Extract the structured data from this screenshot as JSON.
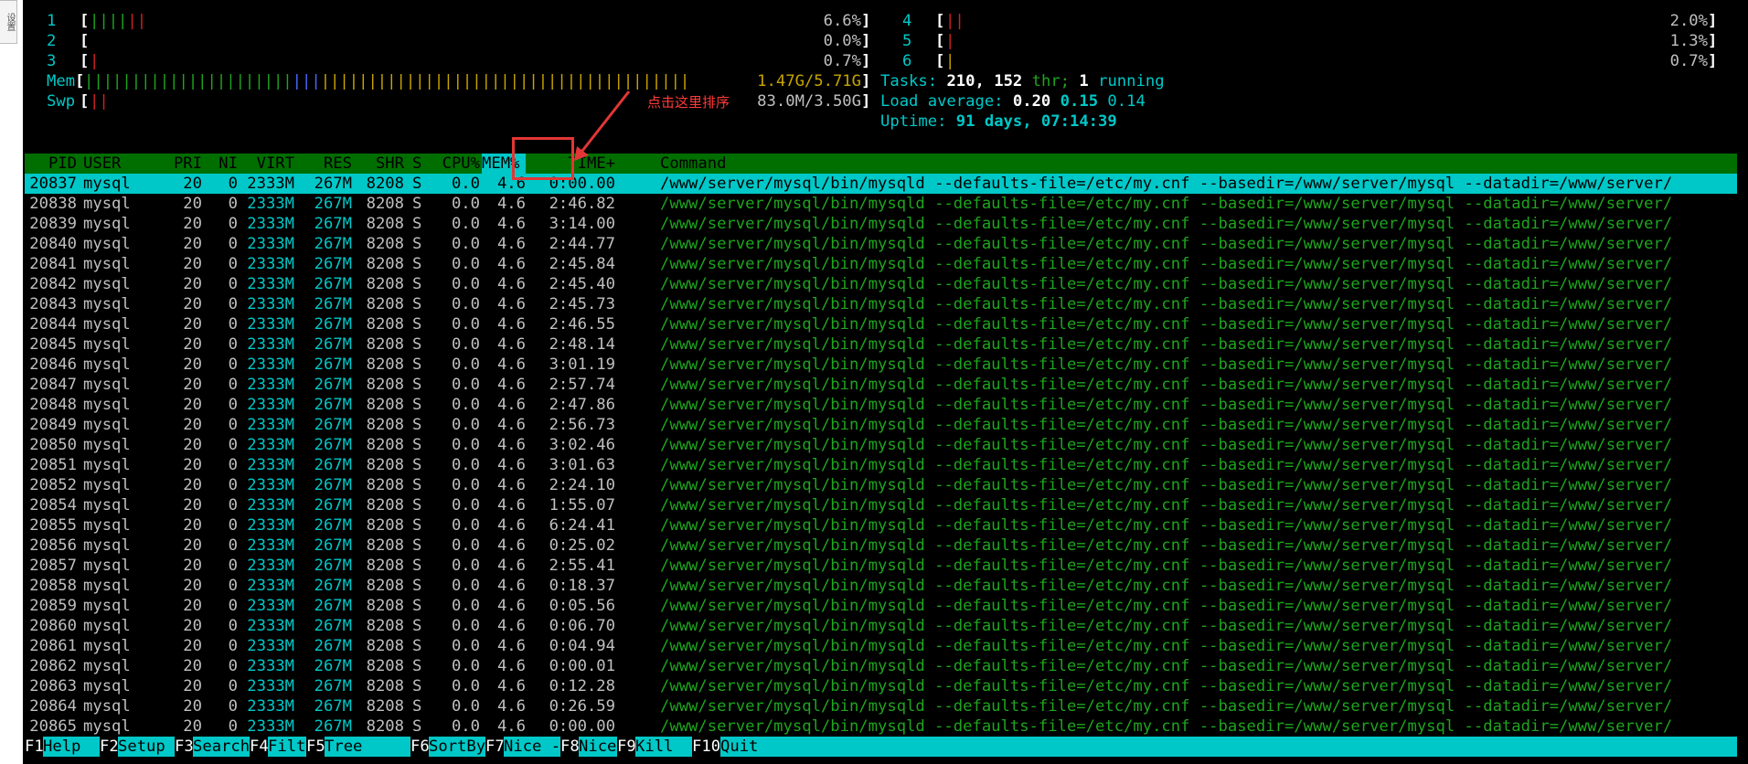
{
  "side_stub": "设置",
  "meters": {
    "cpus": [
      {
        "num": "1",
        "bars": "||||||",
        "value": "6.6%"
      },
      {
        "num": "2",
        "bars": "",
        "value": "0.0%"
      },
      {
        "num": "3",
        "bars": "|",
        "value": "0.7%"
      },
      {
        "num": "4",
        "bars": "||",
        "value": "2.0%"
      },
      {
        "num": "5",
        "bars": "|",
        "value": "1.3%"
      },
      {
        "num": "6",
        "bars": "|",
        "value": "0.7%"
      }
    ],
    "mem_label": "Mem",
    "mem_green_bars": "||||||||||||||||||||||",
    "mem_blue_bars": "|||",
    "mem_yellow_bars": "|||||||||||||||||||||||||||||||||||||||",
    "mem_value": "1.47G/5.71G",
    "swp_label": "Swp",
    "swp_bars": "||",
    "swp_value": "83.0M/3.50G"
  },
  "stats": {
    "tasks_label": "Tasks:",
    "tasks_count": "210,",
    "threads_count": "152",
    "threads_label": "thr;",
    "running_count": "1",
    "running_label": "running",
    "load_label": "Load average:",
    "load_1": "0.20",
    "load_5": "0.15",
    "load_15": "0.14",
    "uptime_label": "Uptime:",
    "uptime_value": "91 days, 07:14:39"
  },
  "annotation": {
    "text": "点击这里排序"
  },
  "table": {
    "columns": [
      "PID",
      "USER",
      "PRI",
      "NI",
      "VIRT",
      "RES",
      "SHR",
      "S",
      "CPU%",
      "MEM%",
      "TIME+",
      "Command"
    ],
    "sorted_column": "MEM%",
    "selected_index": 0,
    "rows": [
      {
        "pid": "20837",
        "user": "mysql",
        "pri": "20",
        "ni": "0",
        "virt": "2333M",
        "res": "267M",
        "shr": "8208",
        "s": "S",
        "cpu": "0.0",
        "mem": "4.6",
        "time": "0:00.00",
        "cmd": "/www/server/mysql/bin/mysqld --defaults-file=/etc/my.cnf --basedir=/www/server/mysql --datadir=/www/server/"
      },
      {
        "pid": "20838",
        "user": "mysql",
        "pri": "20",
        "ni": "0",
        "virt": "2333M",
        "res": "267M",
        "shr": "8208",
        "s": "S",
        "cpu": "0.0",
        "mem": "4.6",
        "time": "2:46.82",
        "cmd": "/www/server/mysql/bin/mysqld --defaults-file=/etc/my.cnf --basedir=/www/server/mysql --datadir=/www/server/"
      },
      {
        "pid": "20839",
        "user": "mysql",
        "pri": "20",
        "ni": "0",
        "virt": "2333M",
        "res": "267M",
        "shr": "8208",
        "s": "S",
        "cpu": "0.0",
        "mem": "4.6",
        "time": "3:14.00",
        "cmd": "/www/server/mysql/bin/mysqld --defaults-file=/etc/my.cnf --basedir=/www/server/mysql --datadir=/www/server/"
      },
      {
        "pid": "20840",
        "user": "mysql",
        "pri": "20",
        "ni": "0",
        "virt": "2333M",
        "res": "267M",
        "shr": "8208",
        "s": "S",
        "cpu": "0.0",
        "mem": "4.6",
        "time": "2:44.77",
        "cmd": "/www/server/mysql/bin/mysqld --defaults-file=/etc/my.cnf --basedir=/www/server/mysql --datadir=/www/server/"
      },
      {
        "pid": "20841",
        "user": "mysql",
        "pri": "20",
        "ni": "0",
        "virt": "2333M",
        "res": "267M",
        "shr": "8208",
        "s": "S",
        "cpu": "0.0",
        "mem": "4.6",
        "time": "2:45.84",
        "cmd": "/www/server/mysql/bin/mysqld --defaults-file=/etc/my.cnf --basedir=/www/server/mysql --datadir=/www/server/"
      },
      {
        "pid": "20842",
        "user": "mysql",
        "pri": "20",
        "ni": "0",
        "virt": "2333M",
        "res": "267M",
        "shr": "8208",
        "s": "S",
        "cpu": "0.0",
        "mem": "4.6",
        "time": "2:45.40",
        "cmd": "/www/server/mysql/bin/mysqld --defaults-file=/etc/my.cnf --basedir=/www/server/mysql --datadir=/www/server/"
      },
      {
        "pid": "20843",
        "user": "mysql",
        "pri": "20",
        "ni": "0",
        "virt": "2333M",
        "res": "267M",
        "shr": "8208",
        "s": "S",
        "cpu": "0.0",
        "mem": "4.6",
        "time": "2:45.73",
        "cmd": "/www/server/mysql/bin/mysqld --defaults-file=/etc/my.cnf --basedir=/www/server/mysql --datadir=/www/server/"
      },
      {
        "pid": "20844",
        "user": "mysql",
        "pri": "20",
        "ni": "0",
        "virt": "2333M",
        "res": "267M",
        "shr": "8208",
        "s": "S",
        "cpu": "0.0",
        "mem": "4.6",
        "time": "2:46.55",
        "cmd": "/www/server/mysql/bin/mysqld --defaults-file=/etc/my.cnf --basedir=/www/server/mysql --datadir=/www/server/"
      },
      {
        "pid": "20845",
        "user": "mysql",
        "pri": "20",
        "ni": "0",
        "virt": "2333M",
        "res": "267M",
        "shr": "8208",
        "s": "S",
        "cpu": "0.0",
        "mem": "4.6",
        "time": "2:48.14",
        "cmd": "/www/server/mysql/bin/mysqld --defaults-file=/etc/my.cnf --basedir=/www/server/mysql --datadir=/www/server/"
      },
      {
        "pid": "20846",
        "user": "mysql",
        "pri": "20",
        "ni": "0",
        "virt": "2333M",
        "res": "267M",
        "shr": "8208",
        "s": "S",
        "cpu": "0.0",
        "mem": "4.6",
        "time": "3:01.19",
        "cmd": "/www/server/mysql/bin/mysqld --defaults-file=/etc/my.cnf --basedir=/www/server/mysql --datadir=/www/server/"
      },
      {
        "pid": "20847",
        "user": "mysql",
        "pri": "20",
        "ni": "0",
        "virt": "2333M",
        "res": "267M",
        "shr": "8208",
        "s": "S",
        "cpu": "0.0",
        "mem": "4.6",
        "time": "2:57.74",
        "cmd": "/www/server/mysql/bin/mysqld --defaults-file=/etc/my.cnf --basedir=/www/server/mysql --datadir=/www/server/"
      },
      {
        "pid": "20848",
        "user": "mysql",
        "pri": "20",
        "ni": "0",
        "virt": "2333M",
        "res": "267M",
        "shr": "8208",
        "s": "S",
        "cpu": "0.0",
        "mem": "4.6",
        "time": "2:47.86",
        "cmd": "/www/server/mysql/bin/mysqld --defaults-file=/etc/my.cnf --basedir=/www/server/mysql --datadir=/www/server/"
      },
      {
        "pid": "20849",
        "user": "mysql",
        "pri": "20",
        "ni": "0",
        "virt": "2333M",
        "res": "267M",
        "shr": "8208",
        "s": "S",
        "cpu": "0.0",
        "mem": "4.6",
        "time": "2:56.73",
        "cmd": "/www/server/mysql/bin/mysqld --defaults-file=/etc/my.cnf --basedir=/www/server/mysql --datadir=/www/server/"
      },
      {
        "pid": "20850",
        "user": "mysql",
        "pri": "20",
        "ni": "0",
        "virt": "2333M",
        "res": "267M",
        "shr": "8208",
        "s": "S",
        "cpu": "0.0",
        "mem": "4.6",
        "time": "3:02.46",
        "cmd": "/www/server/mysql/bin/mysqld --defaults-file=/etc/my.cnf --basedir=/www/server/mysql --datadir=/www/server/"
      },
      {
        "pid": "20851",
        "user": "mysql",
        "pri": "20",
        "ni": "0",
        "virt": "2333M",
        "res": "267M",
        "shr": "8208",
        "s": "S",
        "cpu": "0.0",
        "mem": "4.6",
        "time": "3:01.63",
        "cmd": "/www/server/mysql/bin/mysqld --defaults-file=/etc/my.cnf --basedir=/www/server/mysql --datadir=/www/server/"
      },
      {
        "pid": "20852",
        "user": "mysql",
        "pri": "20",
        "ni": "0",
        "virt": "2333M",
        "res": "267M",
        "shr": "8208",
        "s": "S",
        "cpu": "0.0",
        "mem": "4.6",
        "time": "2:24.10",
        "cmd": "/www/server/mysql/bin/mysqld --defaults-file=/etc/my.cnf --basedir=/www/server/mysql --datadir=/www/server/"
      },
      {
        "pid": "20854",
        "user": "mysql",
        "pri": "20",
        "ni": "0",
        "virt": "2333M",
        "res": "267M",
        "shr": "8208",
        "s": "S",
        "cpu": "0.0",
        "mem": "4.6",
        "time": "1:55.07",
        "cmd": "/www/server/mysql/bin/mysqld --defaults-file=/etc/my.cnf --basedir=/www/server/mysql --datadir=/www/server/"
      },
      {
        "pid": "20855",
        "user": "mysql",
        "pri": "20",
        "ni": "0",
        "virt": "2333M",
        "res": "267M",
        "shr": "8208",
        "s": "S",
        "cpu": "0.0",
        "mem": "4.6",
        "time": "6:24.41",
        "cmd": "/www/server/mysql/bin/mysqld --defaults-file=/etc/my.cnf --basedir=/www/server/mysql --datadir=/www/server/"
      },
      {
        "pid": "20856",
        "user": "mysql",
        "pri": "20",
        "ni": "0",
        "virt": "2333M",
        "res": "267M",
        "shr": "8208",
        "s": "S",
        "cpu": "0.0",
        "mem": "4.6",
        "time": "0:25.02",
        "cmd": "/www/server/mysql/bin/mysqld --defaults-file=/etc/my.cnf --basedir=/www/server/mysql --datadir=/www/server/"
      },
      {
        "pid": "20857",
        "user": "mysql",
        "pri": "20",
        "ni": "0",
        "virt": "2333M",
        "res": "267M",
        "shr": "8208",
        "s": "S",
        "cpu": "0.0",
        "mem": "4.6",
        "time": "2:55.41",
        "cmd": "/www/server/mysql/bin/mysqld --defaults-file=/etc/my.cnf --basedir=/www/server/mysql --datadir=/www/server/"
      },
      {
        "pid": "20858",
        "user": "mysql",
        "pri": "20",
        "ni": "0",
        "virt": "2333M",
        "res": "267M",
        "shr": "8208",
        "s": "S",
        "cpu": "0.0",
        "mem": "4.6",
        "time": "0:18.37",
        "cmd": "/www/server/mysql/bin/mysqld --defaults-file=/etc/my.cnf --basedir=/www/server/mysql --datadir=/www/server/"
      },
      {
        "pid": "20859",
        "user": "mysql",
        "pri": "20",
        "ni": "0",
        "virt": "2333M",
        "res": "267M",
        "shr": "8208",
        "s": "S",
        "cpu": "0.0",
        "mem": "4.6",
        "time": "0:05.56",
        "cmd": "/www/server/mysql/bin/mysqld --defaults-file=/etc/my.cnf --basedir=/www/server/mysql --datadir=/www/server/"
      },
      {
        "pid": "20860",
        "user": "mysql",
        "pri": "20",
        "ni": "0",
        "virt": "2333M",
        "res": "267M",
        "shr": "8208",
        "s": "S",
        "cpu": "0.0",
        "mem": "4.6",
        "time": "0:06.70",
        "cmd": "/www/server/mysql/bin/mysqld --defaults-file=/etc/my.cnf --basedir=/www/server/mysql --datadir=/www/server/"
      },
      {
        "pid": "20861",
        "user": "mysql",
        "pri": "20",
        "ni": "0",
        "virt": "2333M",
        "res": "267M",
        "shr": "8208",
        "s": "S",
        "cpu": "0.0",
        "mem": "4.6",
        "time": "0:04.94",
        "cmd": "/www/server/mysql/bin/mysqld --defaults-file=/etc/my.cnf --basedir=/www/server/mysql --datadir=/www/server/"
      },
      {
        "pid": "20862",
        "user": "mysql",
        "pri": "20",
        "ni": "0",
        "virt": "2333M",
        "res": "267M",
        "shr": "8208",
        "s": "S",
        "cpu": "0.0",
        "mem": "4.6",
        "time": "0:00.01",
        "cmd": "/www/server/mysql/bin/mysqld --defaults-file=/etc/my.cnf --basedir=/www/server/mysql --datadir=/www/server/"
      },
      {
        "pid": "20863",
        "user": "mysql",
        "pri": "20",
        "ni": "0",
        "virt": "2333M",
        "res": "267M",
        "shr": "8208",
        "s": "S",
        "cpu": "0.0",
        "mem": "4.6",
        "time": "0:12.28",
        "cmd": "/www/server/mysql/bin/mysqld --defaults-file=/etc/my.cnf --basedir=/www/server/mysql --datadir=/www/server/"
      },
      {
        "pid": "20864",
        "user": "mysql",
        "pri": "20",
        "ni": "0",
        "virt": "2333M",
        "res": "267M",
        "shr": "8208",
        "s": "S",
        "cpu": "0.0",
        "mem": "4.6",
        "time": "0:26.59",
        "cmd": "/www/server/mysql/bin/mysqld --defaults-file=/etc/my.cnf --basedir=/www/server/mysql --datadir=/www/server/"
      },
      {
        "pid": "20865",
        "user": "mysql",
        "pri": "20",
        "ni": "0",
        "virt": "2333M",
        "res": "267M",
        "shr": "8208",
        "s": "S",
        "cpu": "0.0",
        "mem": "4.6",
        "time": "0:00.00",
        "cmd": "/www/server/mysql/bin/mysqld --defaults-file=/etc/my.cnf --basedir=/www/server/mysql --datadir=/www/server/"
      }
    ]
  },
  "function_keys": [
    {
      "key": "F1",
      "label": "Help"
    },
    {
      "key": "F2",
      "label": "Setup"
    },
    {
      "key": "F3",
      "label": "Search"
    },
    {
      "key": "F4",
      "label": "Filter"
    },
    {
      "key": "F5",
      "label": "Tree"
    },
    {
      "key": "F6",
      "label": "SortBy"
    },
    {
      "key": "F7",
      "label": "Nice -"
    },
    {
      "key": "F8",
      "label": "Nice +"
    },
    {
      "key": "F9",
      "label": "Kill"
    },
    {
      "key": "F10",
      "label": "Quit"
    }
  ],
  "colors": {
    "terminal_bg": "#000000",
    "header_bg": "#006f00",
    "selection_bg": "#00c8c8",
    "command_text": "#1ea51e",
    "annotation": "#e23636"
  }
}
